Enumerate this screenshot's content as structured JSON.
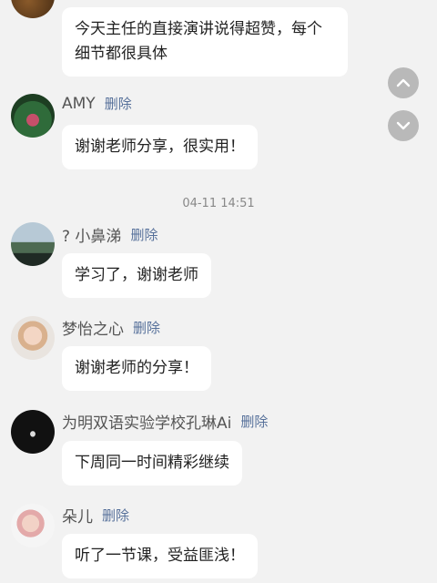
{
  "messages": [
    {
      "name": "",
      "delete_label": "",
      "text": "今天主任的直接演讲说得超赞，每个细节都很具体"
    },
    {
      "name": "AMY",
      "delete_label": "删除",
      "text": "谢谢老师分享，很实用！"
    },
    {
      "name": "? 小鼻涕",
      "delete_label": "删除",
      "text": "学习了，谢谢老师"
    },
    {
      "name": "梦怡之心",
      "delete_label": "删除",
      "text": "谢谢老师的分享！"
    },
    {
      "name": "为明双语实验学校孔琳Ai",
      "delete_label": "删除",
      "text": "下周同一时间精彩继续"
    },
    {
      "name": "朵儿",
      "delete_label": "删除",
      "text": "听了一节课，受益匪浅！"
    }
  ],
  "timestamp": "04-11 14:51",
  "controls": {
    "scroll_up_icon": "chevron-up-icon",
    "scroll_down_icon": "chevron-down-icon"
  },
  "colors": {
    "background": "#f2f2f2",
    "bubble": "#ffffff",
    "delete_link": "#56709a",
    "scroll_button": "#b9b9b9"
  }
}
